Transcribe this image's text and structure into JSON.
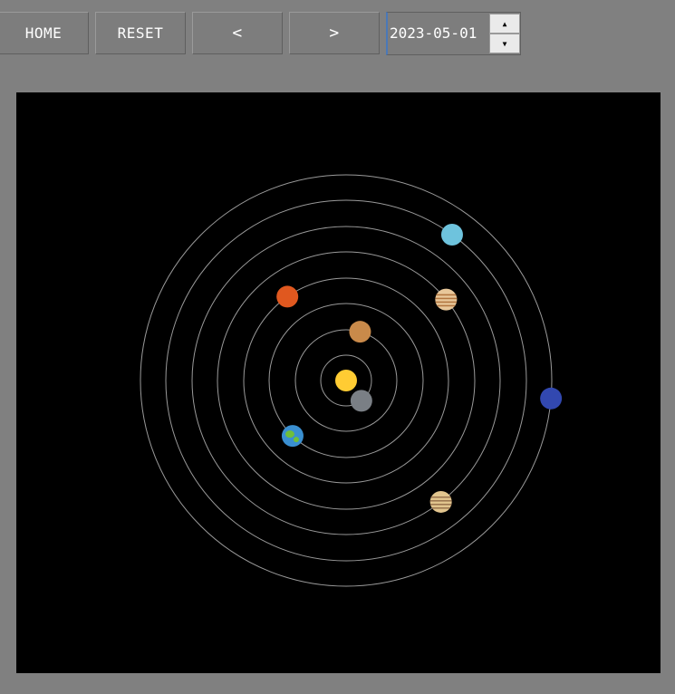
{
  "toolbar": {
    "home_label": "HOME",
    "reset_label": "RESET",
    "prev_label": "<",
    "next_label": ">"
  },
  "date_spinner": {
    "value": "2023-05-01",
    "up_icon": "triangle-up-icon",
    "down_icon": "triangle-down-icon"
  },
  "solar_system": {
    "background": "#000000",
    "orbit_color": "#9a9a9a",
    "sun": {
      "name": "sun",
      "color": "#ffcc33"
    },
    "planets": [
      {
        "name": "mercury",
        "color": "#7a7f85",
        "angle_deg": 143
      },
      {
        "name": "venus",
        "color": "#c98a4a",
        "angle_deg": 16
      },
      {
        "name": "earth",
        "color": "#3a8fd0",
        "accent": "#6fbf3a",
        "angle_deg": 224
      },
      {
        "name": "mars",
        "color": "#e0581f",
        "angle_deg": 325
      },
      {
        "name": "jupiter",
        "color": "#e8c79a",
        "accent": "#b27640",
        "angle_deg": 51
      },
      {
        "name": "saturn",
        "color": "#e2c58e",
        "accent": "#9b7650",
        "angle_deg": 142
      },
      {
        "name": "uranus",
        "color": "#6ec3dd",
        "angle_deg": 36
      },
      {
        "name": "neptune",
        "color": "#3248b0",
        "angle_deg": 95
      }
    ]
  }
}
